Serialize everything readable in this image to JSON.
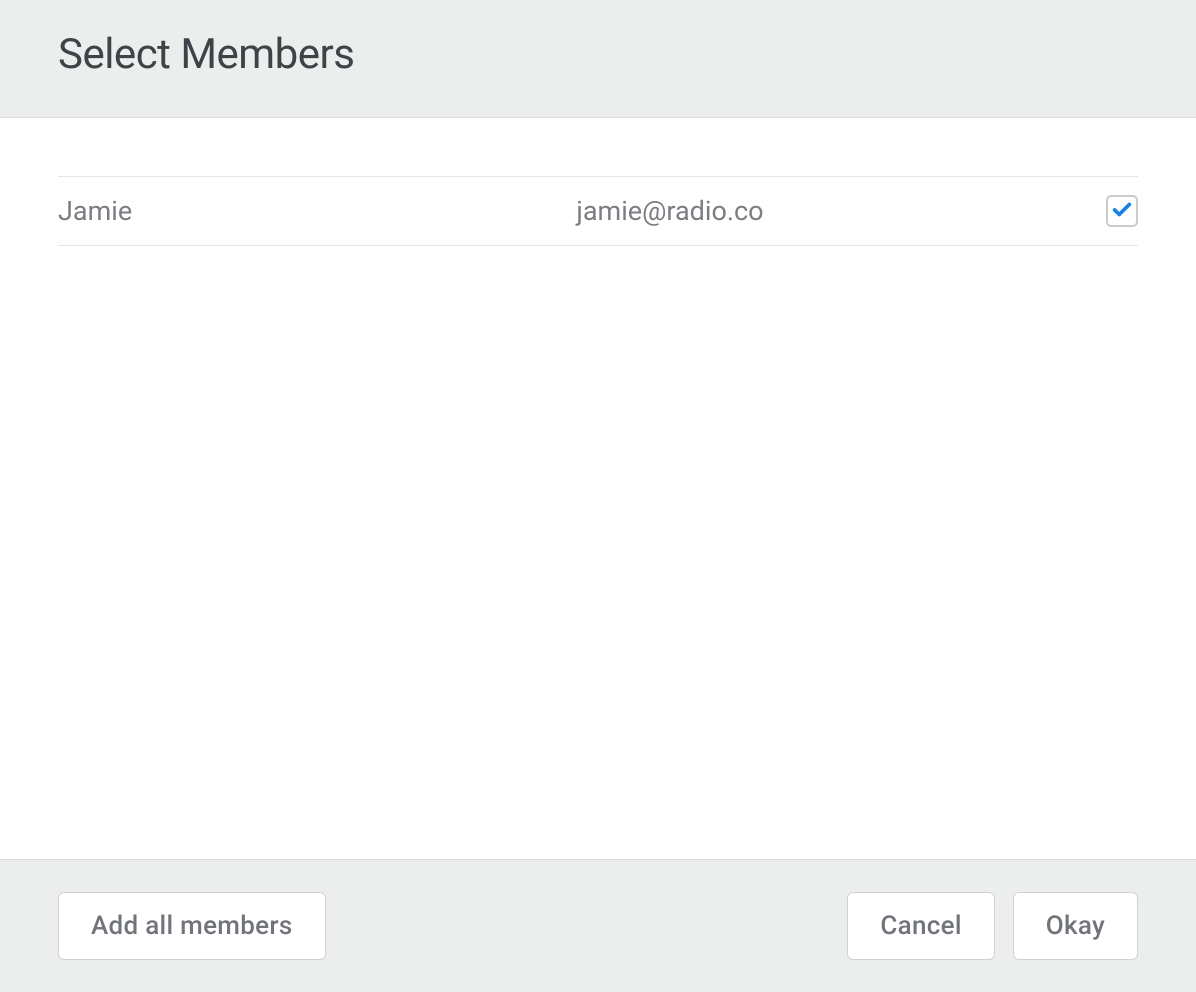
{
  "header": {
    "title": "Select Members"
  },
  "members": [
    {
      "name": "Jamie",
      "email": "jamie@radio.co",
      "checked": true
    }
  ],
  "footer": {
    "add_all_label": "Add all members",
    "cancel_label": "Cancel",
    "okay_label": "Okay"
  },
  "colors": {
    "check_color": "#1881e0"
  }
}
